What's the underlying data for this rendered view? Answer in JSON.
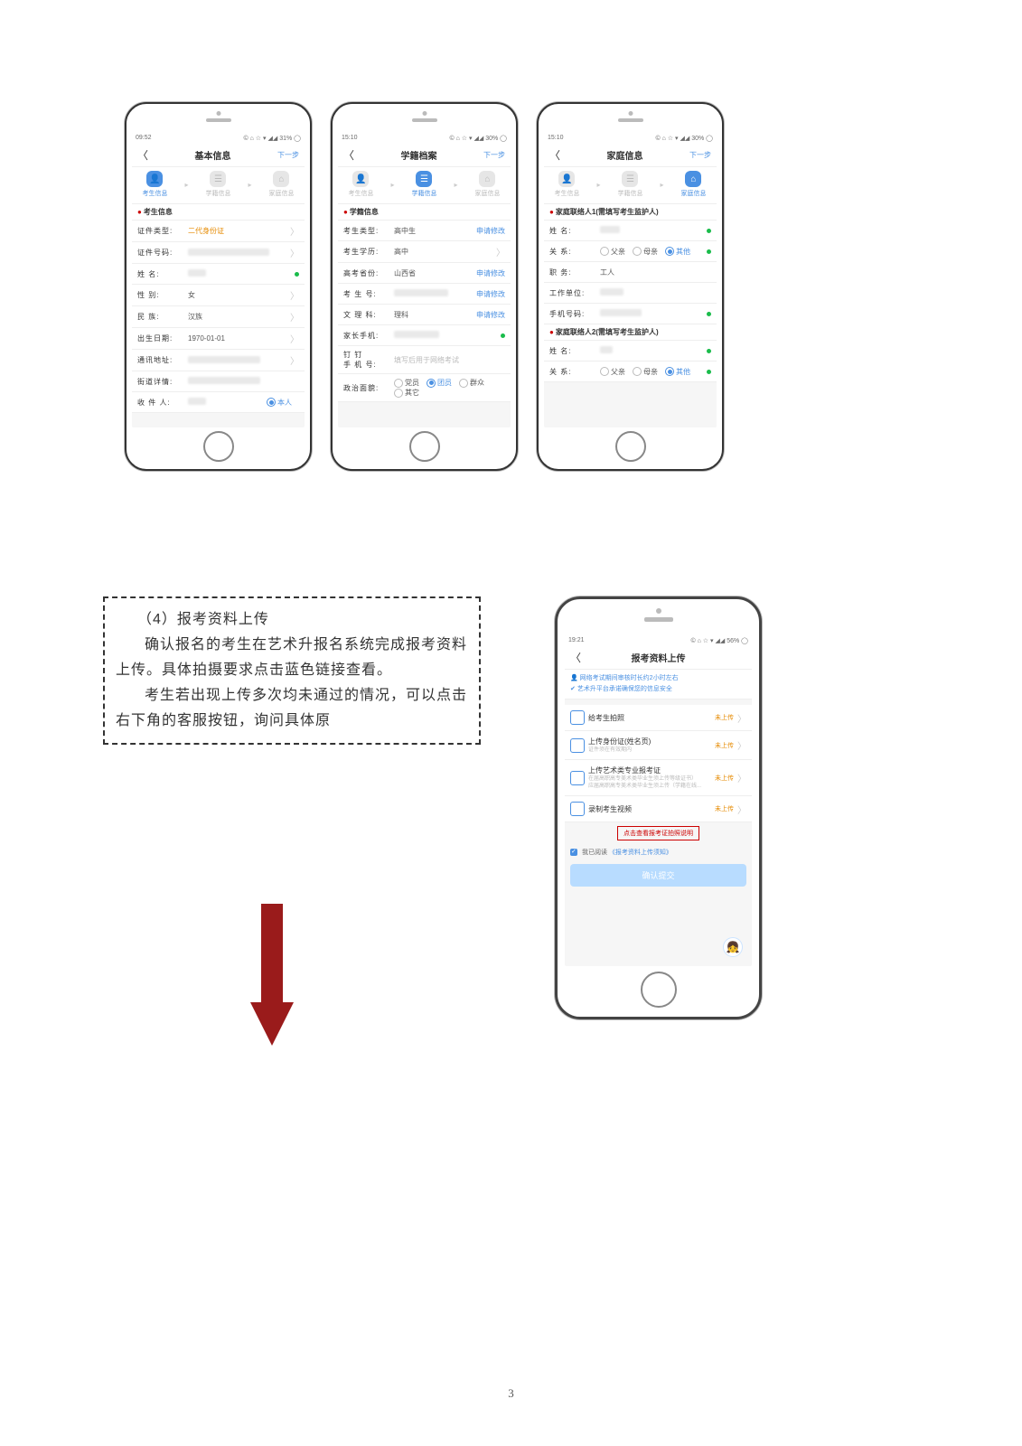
{
  "page_number": "3",
  "phone1": {
    "status": {
      "time": "09:52",
      "right": "© ⌂ ☆ ▾ ◢◢ 31% ◯"
    },
    "nav": {
      "title": "基本信息",
      "next": "下一步"
    },
    "steps": [
      "考生信息",
      "学籍信息",
      "家庭信息"
    ],
    "section": "考生信息",
    "rows": {
      "idtype_label": "证件类型:",
      "idtype_value": "二代身份证",
      "idno_label": "证件号码:",
      "name_label": "姓    名:",
      "gender_label": "性    别:",
      "gender_value": "女",
      "nation_label": "民    族:",
      "nation_value": "汉族",
      "birth_label": "出生日期:",
      "birth_value": "1970-01-01",
      "addr_label": "通讯地址:",
      "street_label": "街道详情:",
      "recip_label": "收 件 人:",
      "recip_self": "本人"
    }
  },
  "phone2": {
    "status": {
      "time": "15:10",
      "right": "© ⌂ ☆ ▾ ◢◢ 30% ◯"
    },
    "nav": {
      "title": "学籍档案",
      "next": "下一步"
    },
    "steps": [
      "考生信息",
      "学籍信息",
      "家庭信息"
    ],
    "section": "学籍信息",
    "rows": {
      "stype_label": "考生类型:",
      "stype_value": "高中生",
      "stype_act": "申请修改",
      "edu_label": "考生学历:",
      "edu_value": "高中",
      "prov_label": "高考省份:",
      "prov_value": "山西省",
      "prov_act": "申请修改",
      "sno_label": "考 生 号:",
      "sno_act": "申请修改",
      "wk_label": "文 理 科:",
      "wk_value": "理科",
      "wk_act": "申请修改",
      "pph_label": "家长手机:",
      "dd_label": "钉  钉\n手 机 号:",
      "dd_value": "填写后用于网络考试",
      "pol_label": "政治面貌:",
      "pol_opts": {
        "a": "党员",
        "b": "团员",
        "c": "群众",
        "d": "其它"
      }
    }
  },
  "phone3": {
    "status": {
      "time": "15:10",
      "right": "© ⌂ ☆ ▾ ◢◢ 30% ◯"
    },
    "nav": {
      "title": "家庭信息",
      "next": "下一步"
    },
    "steps": [
      "考生信息",
      "学籍信息",
      "家庭信息"
    ],
    "section1": "家庭联络人1(需填写考生监护人)",
    "section2": "家庭联络人2(需填写考生监护人)",
    "rows": {
      "name_label": "姓    名:",
      "rel_label": "关    系:",
      "rel_opts": {
        "a": "父亲",
        "b": "母亲",
        "c": "其他"
      },
      "job_label": "职    务:",
      "job_value": "工人",
      "work_label": "工作单位:",
      "phone_label": "手机号码:"
    }
  },
  "phone4": {
    "status": {
      "time": "19:21",
      "right": "© ⌂ ☆ ▾ ◢◢ 56% ◯"
    },
    "nav": {
      "title": "报考资料上传"
    },
    "notes": {
      "n1": "网络考试期间审核时长约2小时左右",
      "n2": "艺术升平台承诺确保您的信息安全"
    },
    "rows": {
      "r1_t": "给考生拍照",
      "r1_tag": "未上传",
      "r2_t": "上传身份证(姓名页)",
      "r2_s": "证件须在有效期内",
      "r2_tag": "未上传",
      "r3_t": "上传艺术类专业报考证",
      "r3_s1": "在届高职高专美术类毕业生须上传等级证书）",
      "r3_s2": "应届高职高专美术类毕业生须上传（学籍在线...",
      "r3_tag": "未上传",
      "r4_t": "录制考生视频",
      "r4_tag": "未上传"
    },
    "link": "点击查看报考证拍照说明",
    "check_prefix": "我已阅读",
    "check_link": "《报考资料上传须知》",
    "submit": "确认提交"
  },
  "textbox": {
    "h": "（4）报考资料上传",
    "p1": "确认报名的考生在艺术升报名系统完成报考资料上传。具体拍摄要求点击蓝色链接查看。",
    "p2": "考生若出现上传多次均未通过的情况，可以点击右下角的客服按钮，询问具体原"
  }
}
